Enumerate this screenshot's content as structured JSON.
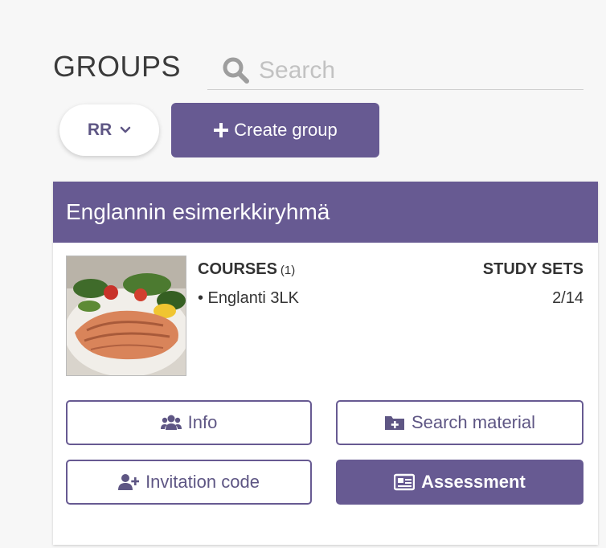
{
  "header": {
    "title": "GROUPS",
    "search_placeholder": "Search"
  },
  "toolbar": {
    "user_selector_label": "RR",
    "create_group_label": "Create group"
  },
  "group_card": {
    "name": "Englannin esimerkkiryhmä",
    "courses_label": "COURSES",
    "courses_count": "(1)",
    "courses": [
      "• Englanti 3LK"
    ],
    "study_sets_label": "STUDY SETS",
    "study_sets_value": "2/14",
    "buttons": {
      "info": "Info",
      "search_material": "Search material",
      "invitation_code": "Invitation code",
      "assessment": "Assessment"
    }
  },
  "colors": {
    "accent": "#675a92",
    "background": "#f7f7f7"
  },
  "icons": [
    "search-icon",
    "chevron-down-icon",
    "plus-icon",
    "users-icon",
    "folder-plus-icon",
    "user-plus-icon",
    "id-card-icon"
  ]
}
